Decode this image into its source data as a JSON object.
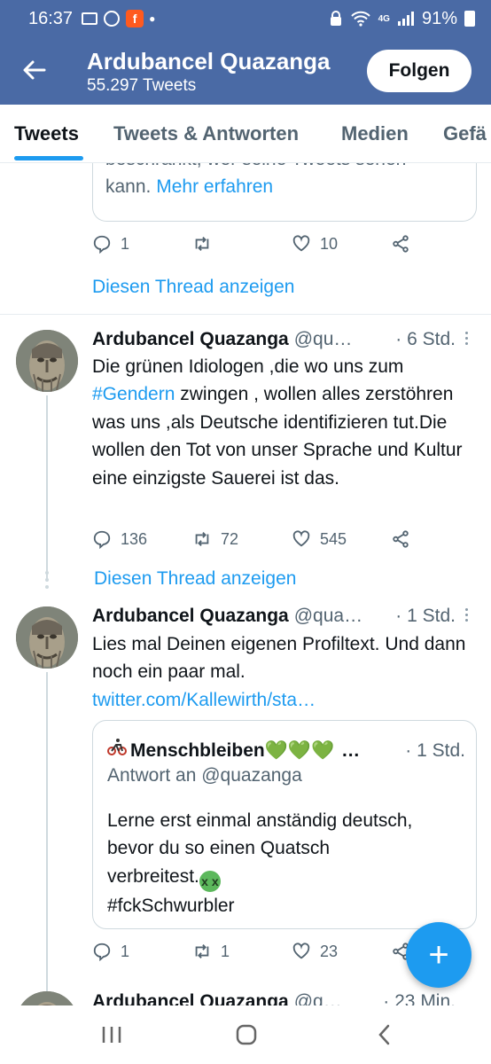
{
  "status_bar": {
    "time": "16:37",
    "signal": "4G",
    "battery": "91%"
  },
  "header": {
    "title": "Ardubancel Quazanga",
    "subtitle": "55.297 Tweets",
    "follow_label": "Folgen"
  },
  "tabs": [
    {
      "label": "Tweets",
      "active": true
    },
    {
      "label": "Tweets & Antworten",
      "active": false
    },
    {
      "label": "Medien",
      "active": false
    },
    {
      "label": "Gefä",
      "active": false
    }
  ],
  "notice": {
    "line1": "beschränkt, wer seine Tweets sehen",
    "line2_prefix": "kann. ",
    "link": "Mehr erfahren"
  },
  "first_actions": {
    "replies": "1",
    "retweets": "",
    "likes": "10"
  },
  "thread_link_label": "Diesen Thread anzeigen",
  "tweets": [
    {
      "name": "Ardubancel Quazanga",
      "handle": "@qu…",
      "time": "· 6 Std.",
      "text_parts": [
        "Die grünen Idiologen ,die wo uns zum ",
        "#Gendern",
        " zwingen , wollen alles zerstöhren was uns ,als Deutsche identifizieren tut.Die wollen den Tot von unser Sprache und Kultur eine einzigste Sauerei ist das."
      ],
      "actions": {
        "replies": "136",
        "retweets": "72",
        "likes": "545"
      },
      "thread_link": "Diesen Thread anzeigen"
    },
    {
      "name": "Ardubancel Quazanga",
      "handle": "@qua…",
      "time": "· 1 Std.",
      "text": "Lies mal Deinen eigenen Profiltext. Und dann noch ein paar mal.",
      "link": "twitter.com/Kallewirth/sta…",
      "quote": {
        "name": "Menschbleiben💚💚💚",
        "dots": "…",
        "time": "· 1 Std.",
        "reply_to": "Antwort an @quazanga",
        "line1": "Lerne erst einmal anständig deutsch,",
        "line2": "bevor du so einen Quatsch",
        "line3": "verbreitest.",
        "hashtag": "#fckSchwurbler"
      },
      "actions": {
        "replies": "1",
        "retweets": "1",
        "likes": "23"
      }
    },
    {
      "name": "Ardubancel Quazanga",
      "handle": "@q…",
      "time": "· 23 Min."
    }
  ],
  "fab_label": "+",
  "colors": {
    "header_bg": "#4a6aa5",
    "accent": "#1d9bf0",
    "text": "#0f1419",
    "secondary_text": "#536471"
  }
}
